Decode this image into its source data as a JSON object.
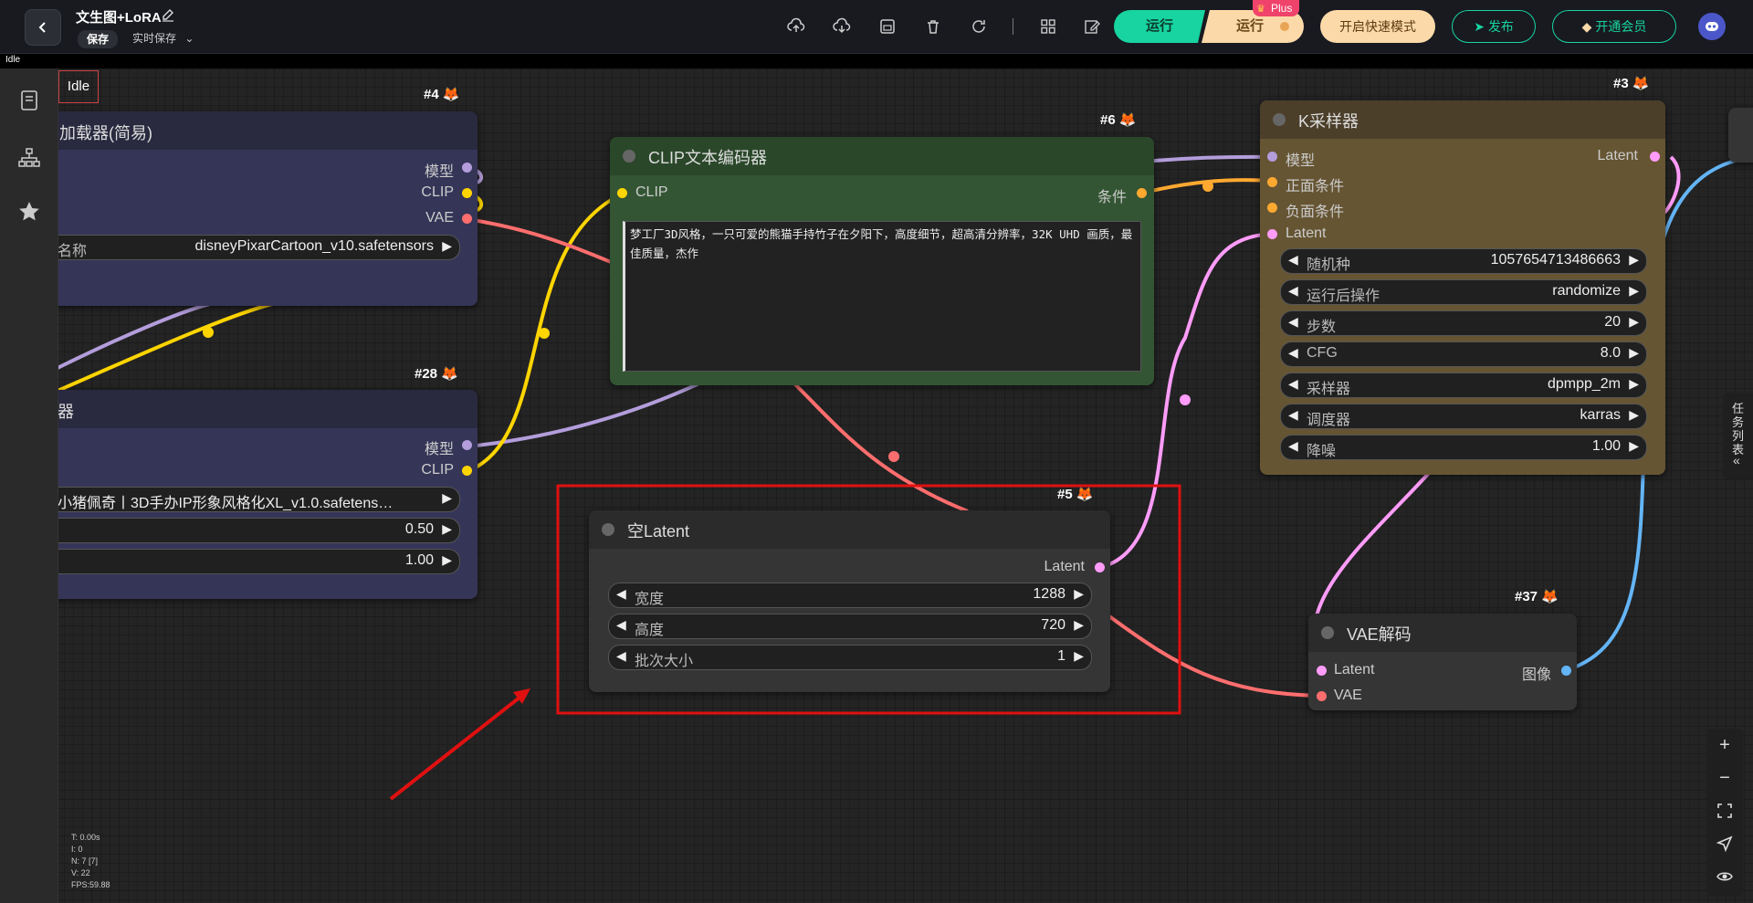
{
  "header": {
    "title": "文生图+LoRA",
    "save_label": "保存",
    "autosave_label": "实时保存",
    "run_label": "运行",
    "run_plus_label": "运行",
    "plus_badge": "Plus",
    "fast_mode_label": "开启快速模式",
    "publish_label": "发布",
    "member_label": "开通会员"
  },
  "status": {
    "strip_text": "Idle",
    "idle_box": "Idle"
  },
  "stats": {
    "t": "T: 0.00s",
    "i": "I: 0",
    "n": "N: 7 [7]",
    "v": "V: 22",
    "fps": "FPS:59.88"
  },
  "right_panel": {
    "task_list_label": "任务列表"
  },
  "nodes": {
    "checkpoint": {
      "id": "#4",
      "title": "加载器(简易)",
      "outputs": [
        "模型",
        "CLIP",
        "VAE"
      ],
      "ckpt_label": "名称",
      "ckpt_value": "disneyPixarCartoon_v10.safetensors"
    },
    "lora": {
      "id": "#28",
      "title": "器",
      "outputs": [
        "模型",
        "CLIP"
      ],
      "lora_name": "小猪佩奇丨3D手办IP形象风格化XL_v1.0.safetens…",
      "strength_model": "0.50",
      "strength_clip": "1.00"
    },
    "clip_encoder": {
      "id": "#6",
      "title": "CLIP文本编码器",
      "input": "CLIP",
      "output": "条件",
      "text": "梦工厂3D风格，一只可爱的熊猫手持竹子在夕阳下，高度细节，超高清分辨率，32K UHD 画质，最佳质量，杰作"
    },
    "ksampler": {
      "id": "#3",
      "title": "K采样器",
      "inputs": [
        "模型",
        "正面条件",
        "负面条件",
        "Latent"
      ],
      "output": "Latent",
      "widgets": [
        {
          "label": "随机种",
          "value": "1057654713486663"
        },
        {
          "label": "运行后操作",
          "value": "randomize"
        },
        {
          "label": "步数",
          "value": "20"
        },
        {
          "label": "CFG",
          "value": "8.0"
        },
        {
          "label": "采样器",
          "value": "dpmpp_2m"
        },
        {
          "label": "调度器",
          "value": "karras"
        },
        {
          "label": "降噪",
          "value": "1.00"
        }
      ]
    },
    "empty_latent": {
      "id": "#5",
      "title": "空Latent",
      "output": "Latent",
      "widgets": [
        {
          "label": "宽度",
          "value": "1288"
        },
        {
          "label": "高度",
          "value": "720"
        },
        {
          "label": "批次大小",
          "value": "1"
        }
      ]
    },
    "vae_decode": {
      "id": "#37",
      "title": "VAE解码",
      "inputs": [
        "Latent",
        "VAE"
      ],
      "output": "图像"
    }
  },
  "colors": {
    "accent": "#17d4a0",
    "plus_pink": "#f0436b",
    "model_port": "#b39ddb",
    "clip_port": "#ffd500",
    "vae_port": "#ff6e6e",
    "cond_port": "#ffa931",
    "latent_port": "#ff9cf9",
    "image_port": "#64b5f6",
    "highlight_red": "#e01010"
  }
}
